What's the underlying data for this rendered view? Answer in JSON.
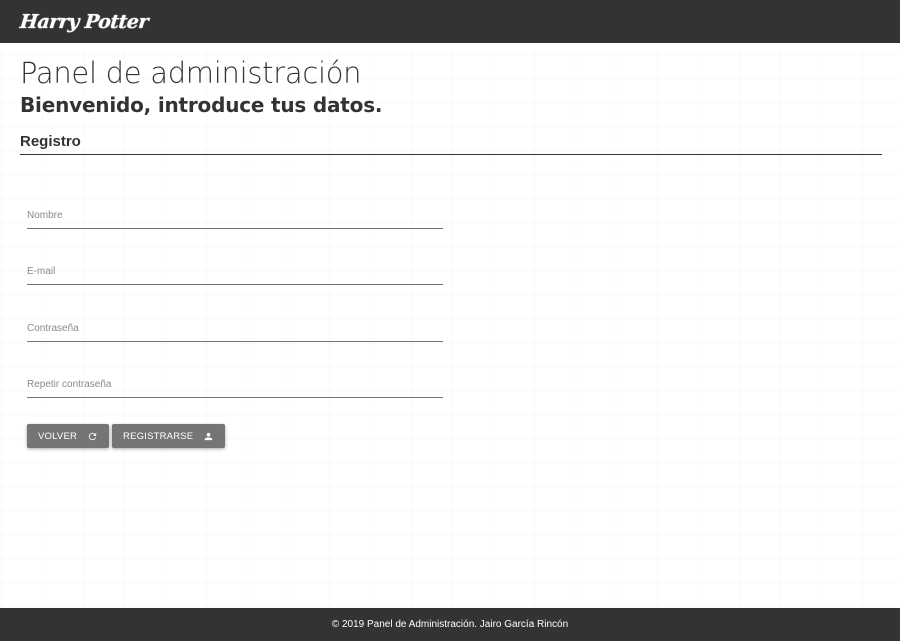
{
  "header": {
    "logo_text": "Harry Potter",
    "background_color": "#333333"
  },
  "main": {
    "title": "Panel de administración",
    "subtitle": "Bienvenido, introduce tus datos.",
    "section_title": "Registro"
  },
  "form": {
    "fields": [
      {
        "placeholder": "Nombre",
        "value": ""
      },
      {
        "placeholder": "E-mail",
        "value": ""
      },
      {
        "placeholder": "Contraseña",
        "value": ""
      },
      {
        "placeholder": "Repetir contraseña",
        "value": ""
      }
    ],
    "buttons": {
      "back_label": "VOLVER",
      "back_icon": "refresh-icon",
      "register_label": "REGISTRARSE",
      "register_icon": "person-icon",
      "color": "#757575"
    }
  },
  "footer": {
    "text": "© 2019 Panel de Administración. Jairo García Rincón"
  }
}
